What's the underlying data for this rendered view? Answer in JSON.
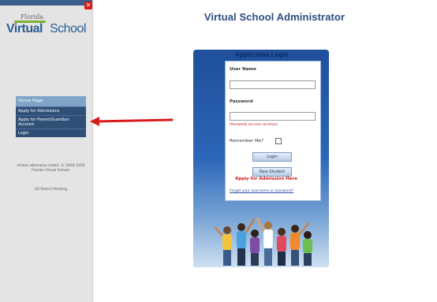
{
  "sidebar": {
    "logo_florida": "Florida",
    "logo_virtual": "Virtual",
    "logo_school": "School",
    "nav": {
      "header": "Home Page",
      "items": [
        {
          "label": "Apply for Admissions"
        },
        {
          "label": "Apply for Parent/Guardian Account"
        },
        {
          "label": "Login"
        }
      ]
    },
    "footer": "Unless otherwise noted, © 2004-2010 Florida Virtual School.",
    "patent": "US Patent Pending"
  },
  "main": {
    "title": "Virtual School Administrator",
    "login": {
      "title": "Application Login",
      "username_label": "User Name",
      "password_label": "Password",
      "password_note": "(Passwords are case sensitive)",
      "remember_label": "Remember Me?",
      "login_button": "Login",
      "new_student_button": "New Student",
      "apply_text": "Apply for Admission Here",
      "forgot_link": "Forgot your username or password?"
    }
  },
  "colors": {
    "sidebar_nav": "#2f4f77",
    "nav_header": "#7fa3c9",
    "title_blue": "#2b4d82",
    "arrow_red": "#d71b1b"
  }
}
